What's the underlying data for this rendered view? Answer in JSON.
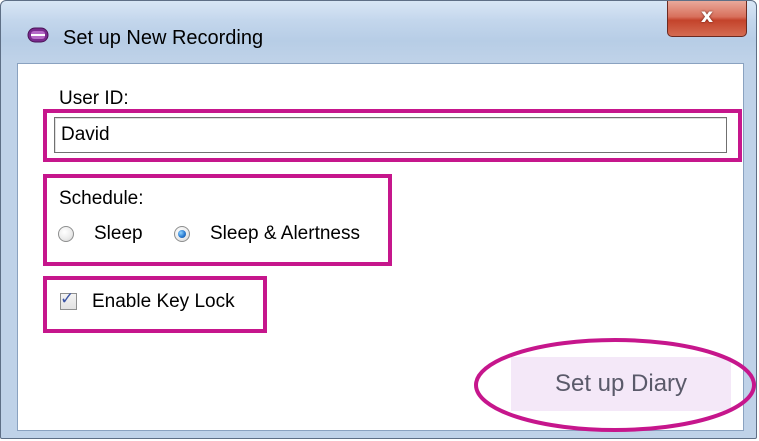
{
  "window": {
    "title": "Set up New Recording",
    "close_label": "x",
    "app_icon": "purple-device-icon"
  },
  "form": {
    "user_id_label": "User ID:",
    "user_id_value": "David",
    "schedule_label": "Schedule:",
    "schedule_options": [
      {
        "label": "Sleep",
        "selected": false
      },
      {
        "label": "Sleep & Alertness",
        "selected": true
      }
    ],
    "key_lock_label": "Enable Key Lock",
    "key_lock_checked": true,
    "submit_label": "Set up Diary"
  },
  "colors": {
    "highlight": "#c6168c",
    "button_bg": "#f4e8f8",
    "close_red": "#c4432b"
  }
}
